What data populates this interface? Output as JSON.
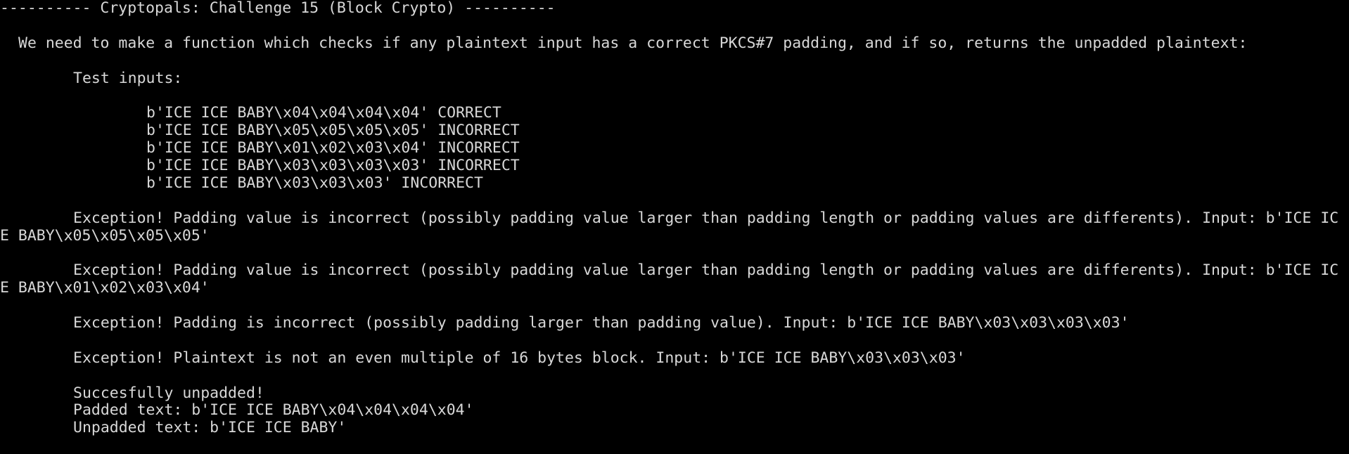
{
  "terminal": {
    "title_line": "---------- Cryptopals: Challenge 15 (Block Crypto) ----------",
    "intro": "We need to make a function which checks if any plaintext input has a correct PKCS#7 padding, and if so, returns the unpadded plaintext:",
    "test_inputs_label": "Test inputs:",
    "test_inputs": [
      "b'ICE ICE BABY\\x04\\x04\\x04\\x04' CORRECT",
      "b'ICE ICE BABY\\x05\\x05\\x05\\x05' INCORRECT",
      "b'ICE ICE BABY\\x01\\x02\\x03\\x04' INCORRECT",
      "b'ICE ICE BABY\\x03\\x03\\x03\\x03' INCORRECT",
      "b'ICE ICE BABY\\x03\\x03\\x03' INCORRECT"
    ],
    "exceptions": [
      {
        "line1": "Exception! Padding value is incorrect (possibly padding value larger than padding length or padding values are differents). Input: b'ICE IC",
        "line2": "E BABY\\x05\\x05\\x05\\x05'"
      },
      {
        "line1": "Exception! Padding value is incorrect (possibly padding value larger than padding length or padding values are differents). Input: b'ICE IC",
        "line2": "E BABY\\x01\\x02\\x03\\x04'"
      },
      {
        "line1": "Exception! Padding is incorrect (possibly padding larger than padding value). Input: b'ICE ICE BABY\\x03\\x03\\x03\\x03'"
      },
      {
        "line1": "Exception! Plaintext is not an even multiple of 16 bytes block. Input: b'ICE ICE BABY\\x03\\x03\\x03'"
      }
    ],
    "success": {
      "message": "Succesfully unpadded!",
      "padded": "Padded text: b'ICE ICE BABY\\x04\\x04\\x04\\x04'",
      "unpadded": "Unpadded text: b'ICE ICE BABY'"
    },
    "colors": {
      "background": "#000000",
      "text": "#d8d8d8"
    }
  }
}
